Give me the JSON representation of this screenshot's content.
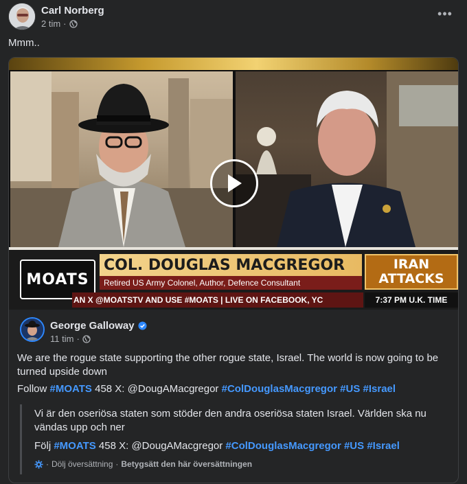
{
  "post": {
    "author": "Carl Norberg",
    "time": "2 tim",
    "separator": "·",
    "more_label": "•••",
    "text": "Mmm.."
  },
  "video": {
    "logo_text": "MOATS",
    "guest_name": "COL. DOUGLAS MACGREGOR",
    "guest_role": "Retired US Army Colonel, Author, Defence Consultant",
    "headline_line1": "IRAN",
    "headline_line2": "ATTACKS",
    "ticker": "AN X @MOATSTV AND USE #MOATS    |    LIVE ON FACEBOOK, YC",
    "clock": "7:37 PM U.K. TIME"
  },
  "shared": {
    "author": "George Galloway",
    "time": "11 tim",
    "separator": "·",
    "body": "We are the rogue state supporting the other rogue state, Israel. The world is now going to be turned upside down",
    "follow_prefix": "Follow",
    "follow_mid": "458 X: @DougAMacgregor",
    "tags": [
      "#MOATS",
      "#ColDouglasMacgregor",
      "#US",
      "#Israel"
    ]
  },
  "translation": {
    "body": "Vi är den oseriösa staten som stöder den andra oseriösa staten Israel. Världen ska nu vändas upp och ner",
    "follow_prefix": "Följ",
    "follow_mid": "458 X: @DougAMacgregor",
    "tags": [
      "#MOATS",
      "#ColDouglasMacgregor",
      "#US",
      "#Israel"
    ],
    "hide_label": "Dölj översättning",
    "separator": "·",
    "rate_label": "Betygsätt den här översättningen"
  },
  "colors": {
    "background": "#242526",
    "hashtag": "#4599ff",
    "verified": "#2d88ff",
    "text_secondary": "#b0b3b8"
  }
}
